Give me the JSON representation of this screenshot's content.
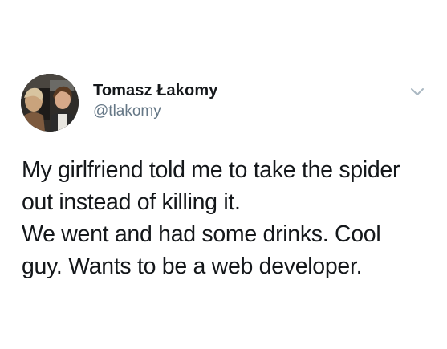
{
  "tweet": {
    "author": {
      "display_name": "Tomasz Łakomy",
      "handle": "@tlakomy",
      "avatar_icon": "profile-photo"
    },
    "menu_icon": "chevron-down-icon",
    "text_lines": [
      "My girlfriend told me to take the spider",
      "out instead of killing it.",
      "We went and had some drinks. Cool",
      "guy. Wants to be a web developer."
    ],
    "colors": {
      "text": "#14171a",
      "secondary": "#657786",
      "caret": "#aab8c2",
      "background": "#ffffff"
    }
  }
}
